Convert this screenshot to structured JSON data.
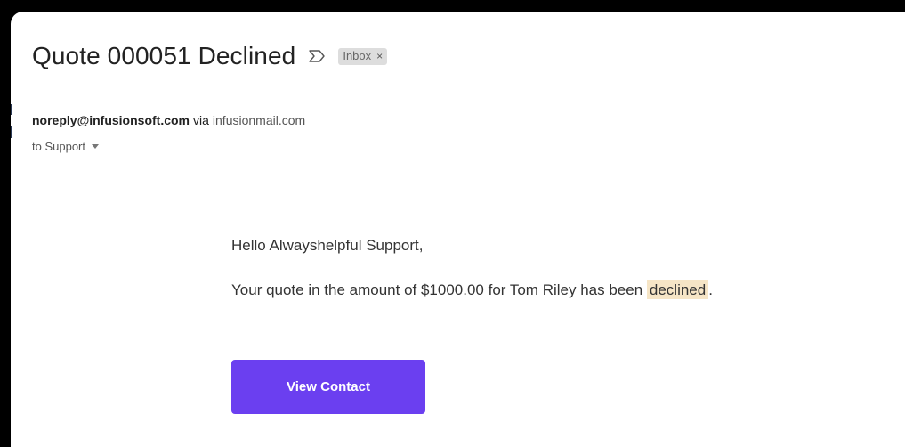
{
  "email": {
    "subject": "Quote 000051 Declined",
    "importance_icon": "importance-marker-icon",
    "label": {
      "name": "Inbox",
      "remove_symbol": "×"
    },
    "sender": {
      "email": "noreply@infusionsoft.com",
      "via_label": "via",
      "via_domain": "infusionmail.com"
    },
    "recipient_text": "to Support",
    "body": {
      "greeting": "Hello Alwayshelpful Support,",
      "message_before": "Your quote in the amount of $1000.00 for Tom Riley has been ",
      "message_highlight": "declined",
      "message_after": "."
    },
    "cta_label": "View Contact"
  },
  "colors": {
    "button": "#6b3ff0",
    "highlight": "#f6e5c6",
    "chip": "#dddddd"
  }
}
